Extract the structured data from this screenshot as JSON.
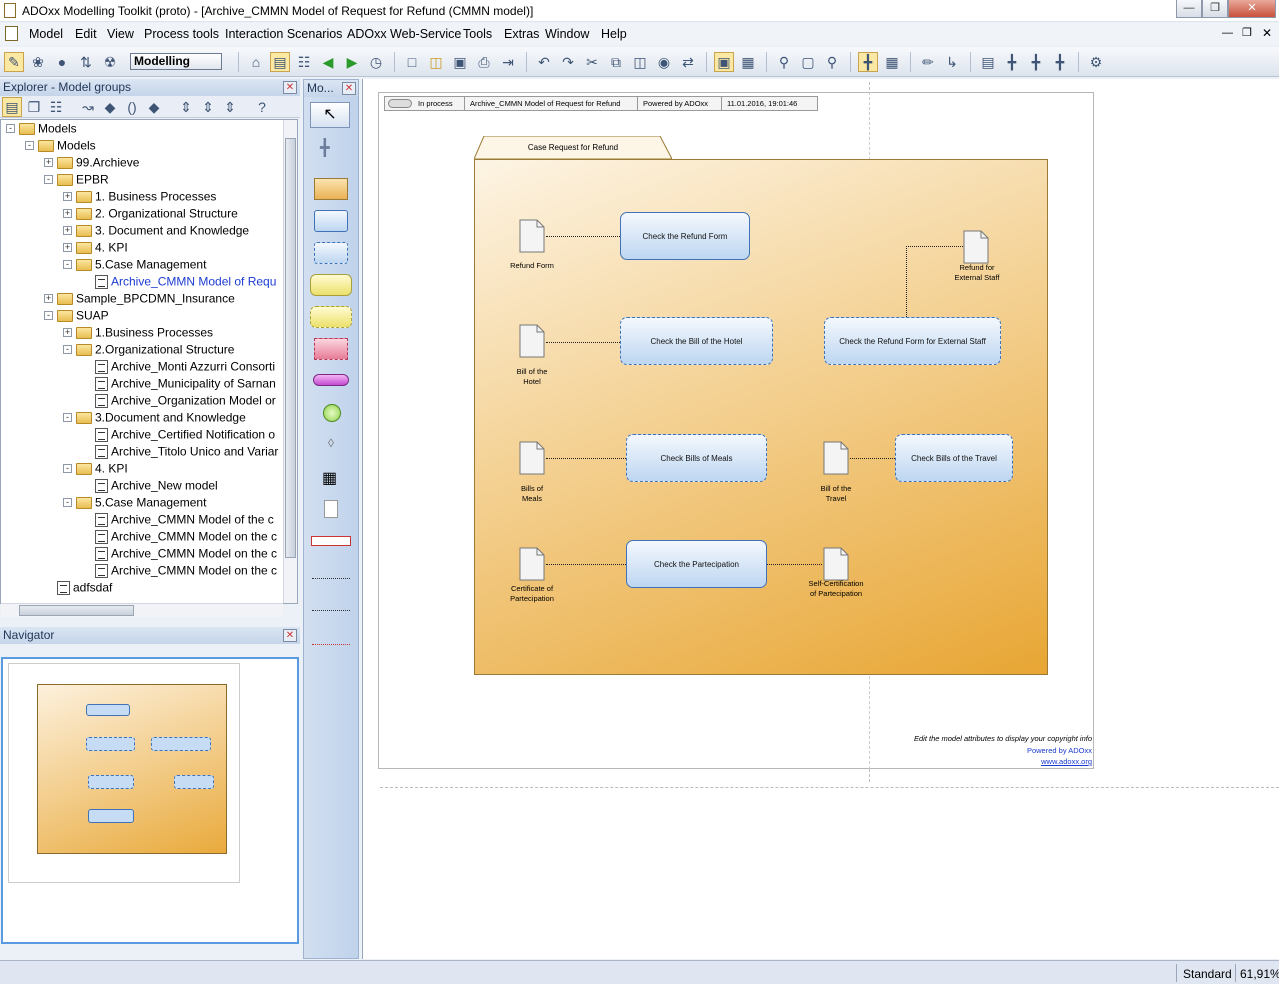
{
  "window": {
    "title": "ADOxx Modelling Toolkit (proto) - [Archive_CMMN Model of Request for Refund (CMMN model)]"
  },
  "menu": [
    {
      "label": "Model",
      "u": "M"
    },
    {
      "label": "Edit",
      "u": "E"
    },
    {
      "label": "View",
      "u": "V"
    },
    {
      "label": "Process tools",
      "u": "P"
    },
    {
      "label": "Interaction Scenarios",
      "u": "I"
    },
    {
      "label": "ADOxx Web-Service",
      "u": "A"
    },
    {
      "label": "Tools",
      "u": "T"
    },
    {
      "label": "Extras",
      "u": "x"
    },
    {
      "label": "Window",
      "u": "W"
    },
    {
      "label": "Help",
      "u": "H"
    }
  ],
  "toolbar": {
    "mode": "Modelling"
  },
  "explorer": {
    "title": "Explorer - Model groups",
    "tree": [
      {
        "label": "Models",
        "lvl": 0,
        "type": "folder",
        "exp": "-"
      },
      {
        "label": "Models",
        "lvl": 1,
        "type": "folder",
        "exp": "-"
      },
      {
        "label": "99.Archieve",
        "lvl": 2,
        "type": "folder",
        "exp": "+"
      },
      {
        "label": "EPBR",
        "lvl": 2,
        "type": "folder",
        "exp": "-"
      },
      {
        "label": "1. Business Processes",
        "lvl": 3,
        "type": "folder",
        "exp": "+"
      },
      {
        "label": "2. Organizational Structure",
        "lvl": 3,
        "type": "folder",
        "exp": "+"
      },
      {
        "label": "3. Document and Knowledge",
        "lvl": 3,
        "type": "folder",
        "exp": "+"
      },
      {
        "label": "4. KPI",
        "lvl": 3,
        "type": "folder",
        "exp": "+"
      },
      {
        "label": "5.Case Management",
        "lvl": 3,
        "type": "folder",
        "exp": "-"
      },
      {
        "label": "Archive_CMMN Model of Requ",
        "lvl": 4,
        "type": "model",
        "sel": true
      },
      {
        "label": "Sample_BPCDMN_Insurance",
        "lvl": 2,
        "type": "folder",
        "exp": "+"
      },
      {
        "label": "SUAP",
        "lvl": 2,
        "type": "folder",
        "exp": "-"
      },
      {
        "label": "1.Business Processes",
        "lvl": 3,
        "type": "folder",
        "exp": "+"
      },
      {
        "label": "2.Organizational Structure",
        "lvl": 3,
        "type": "folder",
        "exp": "-"
      },
      {
        "label": "Archive_Monti Azzurri Consorti",
        "lvl": 4,
        "type": "model"
      },
      {
        "label": "Archive_Municipality of Sarnan",
        "lvl": 4,
        "type": "model"
      },
      {
        "label": "Archive_Organization Model or",
        "lvl": 4,
        "type": "model"
      },
      {
        "label": "3.Document and Knowledge",
        "lvl": 3,
        "type": "folder",
        "exp": "-"
      },
      {
        "label": "Archive_Certified Notification o",
        "lvl": 4,
        "type": "model"
      },
      {
        "label": "Archive_Titolo Unico and Variar",
        "lvl": 4,
        "type": "model"
      },
      {
        "label": "4. KPI",
        "lvl": 3,
        "type": "folder",
        "exp": "-"
      },
      {
        "label": "Archive_New model",
        "lvl": 4,
        "type": "model"
      },
      {
        "label": "5.Case Management",
        "lvl": 3,
        "type": "folder",
        "exp": "-"
      },
      {
        "label": "Archive_CMMN Model of the c",
        "lvl": 4,
        "type": "model"
      },
      {
        "label": "Archive_CMMN Model on the c",
        "lvl": 4,
        "type": "model"
      },
      {
        "label": "Archive_CMMN Model on the c",
        "lvl": 4,
        "type": "model"
      },
      {
        "label": "Archive_CMMN Model on the c",
        "lvl": 4,
        "type": "model"
      },
      {
        "label": "adfsdaf",
        "lvl": 2,
        "type": "model"
      }
    ]
  },
  "navigator": {
    "title": "Navigator"
  },
  "palette": {
    "title": "Mo..."
  },
  "diagram": {
    "header": {
      "status": "In process",
      "name": "Archive_CMMN Model of Request for Refund",
      "powered": "Powered by ADOxx",
      "date": "11.01.2016, 19:01:46"
    },
    "case_title": "Case Request for Refund",
    "tasks": [
      "Check the Refund Form",
      "Check the Bill of the Hotel",
      "Check the Refund Form for External Staff",
      "Check Bills of Meals",
      "Check Bills of the Travel",
      "Check the Partecipation"
    ],
    "docs": [
      "Refund Form",
      "Refund for External Staff",
      "Bill of the Hotel",
      "Bills of Meals",
      "Bill of the Travel",
      "Certificate of Partecipation",
      "Self-Certification of Partecipation"
    ],
    "copyright": {
      "line1": "Edit the model attributes to display your copyright info",
      "line2": "Powered by ADOxx",
      "line3": "www.adoxx.org"
    }
  },
  "status": {
    "mode": "Standard",
    "zoom": "61,91%"
  }
}
